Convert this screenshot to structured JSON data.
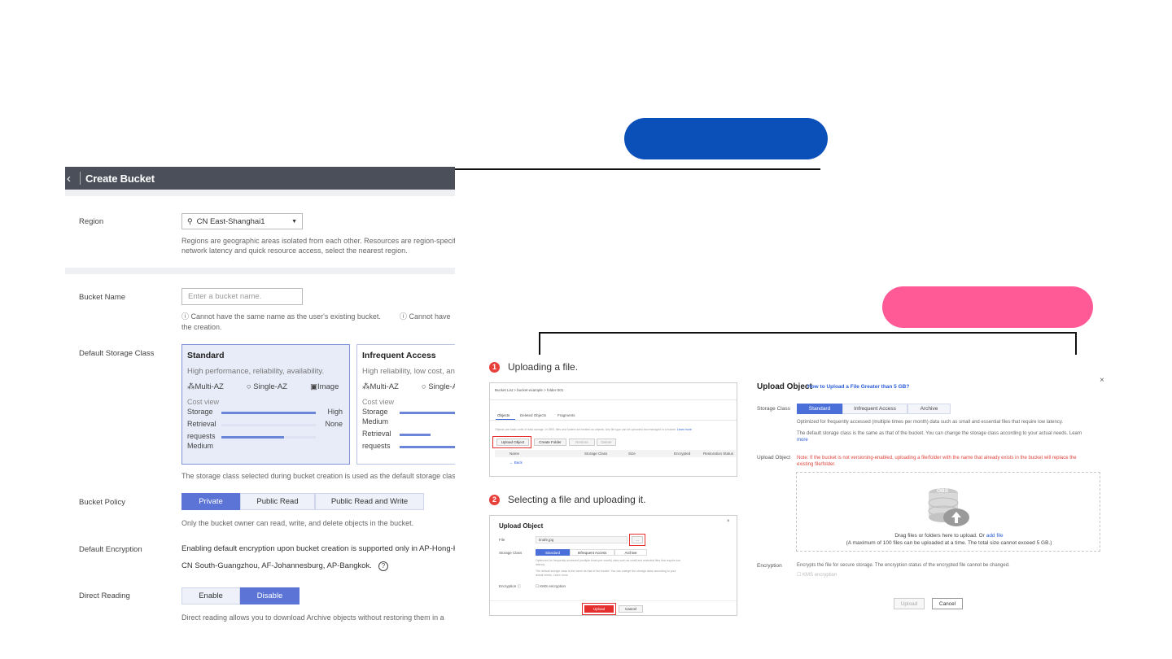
{
  "create_bucket": {
    "title": "Create Bucket",
    "region": {
      "label": "Region",
      "value": "CN East-Shanghai1",
      "hint_line1": "Regions are geographic areas isolated from each other. Resources are region-specif",
      "hint_line2": "network latency and quick resource access, select the nearest region."
    },
    "bucket_name": {
      "label": "Bucket Name",
      "placeholder": "Enter a bucket name.",
      "hint_line1": "Cannot have the same name as the user's existing bucket.",
      "hint_line1b": "Cannot have",
      "hint_line2": "the creation."
    },
    "storage_class": {
      "label": "Default Storage Class",
      "cards": [
        {
          "title": "Standard",
          "desc": "High performance, reliability, availability.",
          "opts": [
            "Multi-AZ",
            "Single-AZ",
            "Image"
          ],
          "cost_view": "Cost view",
          "rows": [
            "Storage",
            "Retrieval",
            "requests"
          ],
          "right": [
            "High",
            "None"
          ],
          "extra": "Medium"
        },
        {
          "title": "Infrequent Access",
          "desc": "High reliability, low cost, and",
          "opts": [
            "Multi-AZ",
            "Single-AZ"
          ],
          "cost_view": "Cost view",
          "rows": [
            "Storage",
            "Medium",
            "Retrieval",
            "requests"
          ]
        }
      ],
      "footnote": "The storage class selected during bucket creation is used as the default storage clas"
    },
    "bucket_policy": {
      "label": "Bucket Policy",
      "options": [
        "Private",
        "Public Read",
        "Public Read and Write"
      ],
      "selected": "Private",
      "hint": "Only the bucket owner can read, write, and delete objects in the bucket."
    },
    "default_encryption": {
      "label": "Default Encryption",
      "line1": "Enabling default encryption upon bucket creation is supported only in AP-Hong-Ko",
      "line2": "CN South-Guangzhou, AF-Johannesburg, AP-Bangkok.",
      "help": "?"
    },
    "direct_reading": {
      "label": "Direct Reading",
      "options": [
        "Enable",
        "Disable"
      ],
      "selected": "Disable",
      "hint": "Direct reading allows you to download Archive objects without restoring them in a"
    }
  },
  "steps": [
    {
      "num": "1",
      "text": "Uploading a file."
    },
    {
      "num": "2",
      "text": "Selecting a file and uploading it."
    }
  ],
  "shot1": {
    "breadcrumb": "Bucket List > bucket-example > folder-001",
    "tabs": [
      "Objects",
      "Deleted Objects",
      "Fragments"
    ],
    "info": "Objects are basic units of data storage. In OBS, files and folders are treated as objects. Any file type can be uploaded and managed in a bucket.",
    "info_link": "Learn more",
    "buttons": [
      "Upload Object",
      "Create Folder",
      "Restore",
      "Delete"
    ],
    "columns": [
      "Name",
      "Storage Class",
      "Size",
      "Encrypted",
      "Restoration Status"
    ],
    "back": "Back"
  },
  "shot2": {
    "title": "Upload Object",
    "file_label": "File",
    "file_value": "tinafe.jpg",
    "browse": "...",
    "storage_label": "Storage Class",
    "storage_opts": [
      "Standard",
      "Infrequent Access",
      "Archive"
    ],
    "storage_desc1": "Optimized for frequently accessed (multiple times per month) data such as small and essential files that require low",
    "storage_desc1b": "latency.",
    "storage_desc2": "The default storage class is the same as that of the bucket. You can change the storage class according to your",
    "storage_desc2b": "actual needs. Learn more",
    "encryption_label": "Encryption",
    "kms": "KMS encryption",
    "upload": "Upload",
    "cancel": "Cancel"
  },
  "upload_dialog": {
    "title": "Upload Object",
    "link": "How to Upload a File Greater than 5 GB?",
    "close": "×",
    "storage_label": "Storage Class",
    "storage_opts": [
      "Standard",
      "Infrequent Access",
      "Archive"
    ],
    "storage_selected": "Standard",
    "desc1": "Optimized for frequently accessed (multiple times per month) data such as small and essential files that require low latency.",
    "desc2": "The default storage class is the same as that of the bucket. You can change the storage class according to your actual needs. Learn",
    "desc2b": "more",
    "object_label": "Upload Object",
    "note1": "Note: If the bucket is not versioning-enabled, uploading a file/folder with the name that already exists in the bucket will replace the",
    "note2": "existing file/folder.",
    "obs_logo": "OBS",
    "drop_text": "Drag files or folders here to upload. Or",
    "drop_link": "add file",
    "drop_limit": "(A maximum of 100 files can be uploaded at a time. The total size cannot exceed 5 GB.)",
    "encryption_label": "Encryption",
    "encryption_desc": "Encrypts the file for secure storage. The encryption status of the encrypted file cannot be changed.",
    "kms": "KMS encryption",
    "upload": "Upload",
    "cancel": "Cancel"
  }
}
